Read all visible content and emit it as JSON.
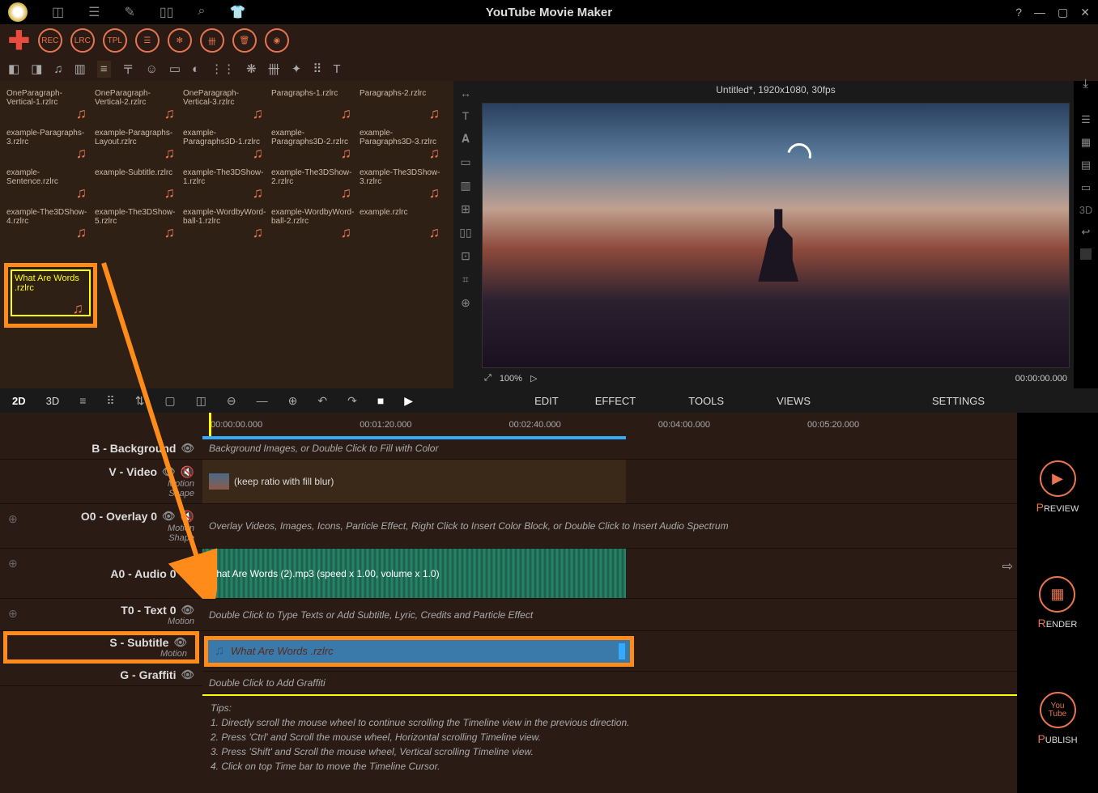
{
  "app": {
    "title": "YouTube Movie Maker"
  },
  "project": {
    "title": "Untitled*, 1920x1080, 30fps"
  },
  "circ_buttons": [
    "REC",
    "LRC",
    "TPL"
  ],
  "assets": [
    "OneParagraph-Vertical-1.rzlrc",
    "OneParagraph-Vertical-2.rzlrc",
    "OneParagraph-Vertical-3.rzlrc",
    "Paragraphs-1.rzlrc",
    "Paragraphs-2.rzlrc",
    "example-Paragraphs-3.rzlrc",
    "example-Paragraphs-Layout.rzlrc",
    "example-Paragraphs3D-1.rzlrc",
    "example-Paragraphs3D-2.rzlrc",
    "example-Paragraphs3D-3.rzlrc",
    "example-Sentence.rzlrc",
    "example-Subtitle.rzlrc",
    "example-The3DShow-1.rzlrc",
    "example-The3DShow-2.rzlrc",
    "example-The3DShow-3.rzlrc",
    "example-The3DShow-4.rzlrc",
    "example-The3DShow-5.rzlrc",
    "example-WordbyWord-ball-1.rzlrc",
    "example-WordbyWord-ball-2.rzlrc",
    "example.rzlrc"
  ],
  "selected_asset": "What Are Words .rzlrc",
  "preview": {
    "zoom": "100%",
    "time": "00:00:00.000"
  },
  "tabs": {
    "t2d": "2D",
    "t3d": "3D",
    "edit": "EDIT",
    "effect": "EFFECT",
    "tools": "TOOLS",
    "views": "VIEWS",
    "settings": "SETTINGS"
  },
  "ruler": [
    "00:00:00.000",
    "00:01:20.000",
    "00:02:40.000",
    "00:04:00.000",
    "00:05:20.000"
  ],
  "tracks": {
    "background": {
      "title": "B - Background",
      "hint": "Background Images, or Double Click to Fill with Color"
    },
    "video": {
      "title": "V - Video",
      "sub1": "Motion",
      "sub2": "Shape",
      "clip": "(keep ratio with fill blur)"
    },
    "overlay": {
      "title": "O0 - Overlay 0",
      "sub1": "Motion",
      "sub2": "Shape",
      "hint": "Overlay Videos, Images, Icons, Particle Effect, Right Click to Insert Color Block, or Double Click to Insert Audio Spectrum"
    },
    "audio": {
      "title": "A0 - Audio 0",
      "clip": "What Are Words (2).mp3  (speed x 1.00, volume x 1.0)"
    },
    "text": {
      "title": "T0 - Text 0",
      "sub1": "Motion",
      "hint": "Double Click to Type Texts or Add Subtitle, Lyric, Credits and Particle Effect"
    },
    "subtitle": {
      "title": "S - Subtitle",
      "sub1": "Motion",
      "clip": "What Are Words .rzlrc"
    },
    "graffiti": {
      "title": "G - Graffiti",
      "hint": "Double Click to Add Graffiti"
    }
  },
  "tips": {
    "h": "Tips:",
    "l1": "1. Directly scroll the mouse wheel to continue scrolling the Timeline view in the previous direction.",
    "l2": "2. Press 'Ctrl' and Scroll the mouse wheel, Horizontal scrolling Timeline view.",
    "l3": "3. Press 'Shift' and Scroll the mouse wheel, Vertical scrolling Timeline view.",
    "l4": "4. Click on top Time bar to move the Timeline Cursor."
  },
  "actions": {
    "preview": "REVIEW",
    "render": "ENDER",
    "publish": "UBLISH",
    "youtube1": "You",
    "youtube2": "Tube"
  }
}
